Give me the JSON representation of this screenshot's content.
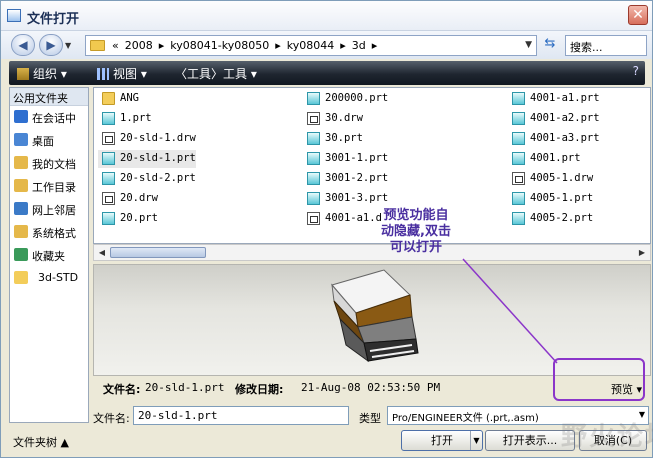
{
  "window": {
    "title": "文件打开",
    "close_glyph": "✕"
  },
  "address": {
    "back_glyph": "◀",
    "forward_glyph": "▶",
    "crumbs": [
      "«",
      "2008",
      "▸",
      "ky08041-ky08050",
      "▸",
      "ky08044",
      "▸",
      "3d",
      "▸"
    ],
    "refresh_glyph": "⇆",
    "search_placeholder": "搜索..."
  },
  "toolbar": {
    "organize": "组织 ▾",
    "views": "视图 ▾",
    "tools": "〈工具〉工具 ▾",
    "help_glyph": "?"
  },
  "sidebar": {
    "header": "公用文件夹",
    "items": [
      {
        "label": "在会话中",
        "icon": "session-icon",
        "color": "#2f6fd0"
      },
      {
        "label": "桌面",
        "icon": "desktop-icon",
        "color": "#4a86d4"
      },
      {
        "label": "我的文档",
        "icon": "documents-icon",
        "color": "#e5b84a"
      },
      {
        "label": "工作目录",
        "icon": "workdir-icon",
        "color": "#e5b84a"
      },
      {
        "label": "网上邻居",
        "icon": "network-icon",
        "color": "#3b7ac7"
      },
      {
        "label": "系统格式",
        "icon": "system-format-icon",
        "color": "#e5b84a"
      },
      {
        "label": "收藏夹",
        "icon": "favorites-icon",
        "color": "#3a9a5a"
      },
      {
        "label": "3d-STD",
        "icon": "folder-icon",
        "color": "#f3cd5a"
      }
    ]
  },
  "files": {
    "col1": [
      {
        "name": "ANG",
        "type": "folder"
      },
      {
        "name": "1.prt",
        "type": "part"
      },
      {
        "name": "20-sld-1.drw",
        "type": "drw"
      },
      {
        "name": "20-sld-1.prt",
        "type": "part",
        "selected": true
      },
      {
        "name": "20-sld-2.prt",
        "type": "part"
      },
      {
        "name": "20.drw",
        "type": "drw"
      },
      {
        "name": "20.prt",
        "type": "part"
      }
    ],
    "col2": [
      {
        "name": "200000.prt",
        "type": "part"
      },
      {
        "name": "30.drw",
        "type": "drw"
      },
      {
        "name": "30.prt",
        "type": "part"
      },
      {
        "name": "3001-1.prt",
        "type": "part"
      },
      {
        "name": "3001-2.prt",
        "type": "part"
      },
      {
        "name": "3001-3.prt",
        "type": "part"
      },
      {
        "name": "4001-a1.d",
        "type": "drw"
      }
    ],
    "col3": [
      {
        "name": "4001-a1.prt",
        "type": "part"
      },
      {
        "name": "4001-a2.prt",
        "type": "part"
      },
      {
        "name": "4001-a3.prt",
        "type": "part"
      },
      {
        "name": "4001.prt",
        "type": "part"
      },
      {
        "name": "4005-1.drw",
        "type": "drw"
      },
      {
        "name": "4005-1.prt",
        "type": "part"
      },
      {
        "name": "4005-2.prt",
        "type": "part"
      }
    ]
  },
  "status": {
    "filename_label": "文件名:",
    "filename_value": "20-sld-1.prt",
    "modified_label": "修改日期:",
    "modified_value": "21-Aug-08 02:53:50 PM",
    "preview_toggle": "预览 ▾"
  },
  "form": {
    "filename_label": "文件名:",
    "filename_value": "20-sld-1.prt",
    "type_label": "类型",
    "type_value": "Pro/ENGINEER文件 (.prt,.asm)"
  },
  "bottom": {
    "folder_tree": "文件夹树 ▲",
    "open": "打开",
    "open_show": "打开表示...",
    "cancel": "取消(C)"
  },
  "annotation": {
    "line1": "预览功能自",
    "line2": "动隐藏,双击",
    "line3": "可以打开"
  },
  "watermark": "野火论坛"
}
